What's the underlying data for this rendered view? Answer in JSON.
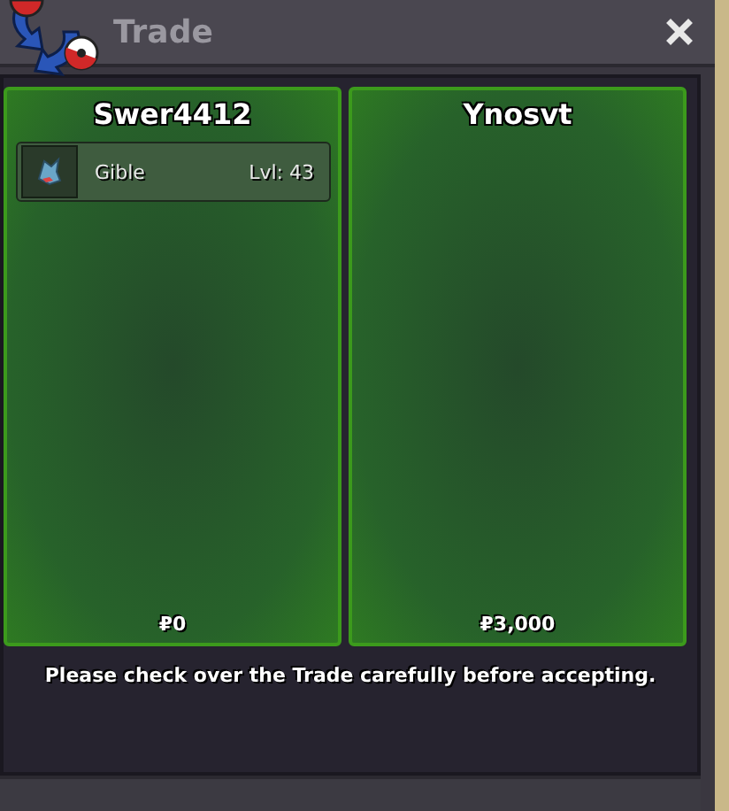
{
  "window": {
    "title": "Trade"
  },
  "traders": [
    {
      "name": "Swer4412",
      "items": [
        {
          "name": "Gible",
          "level": "Lvl: 43"
        }
      ],
      "money": "₽0"
    },
    {
      "name": "Ynosvt",
      "money": "₽3,000"
    }
  ],
  "notice": "Please check over the Trade carefully before accepting."
}
